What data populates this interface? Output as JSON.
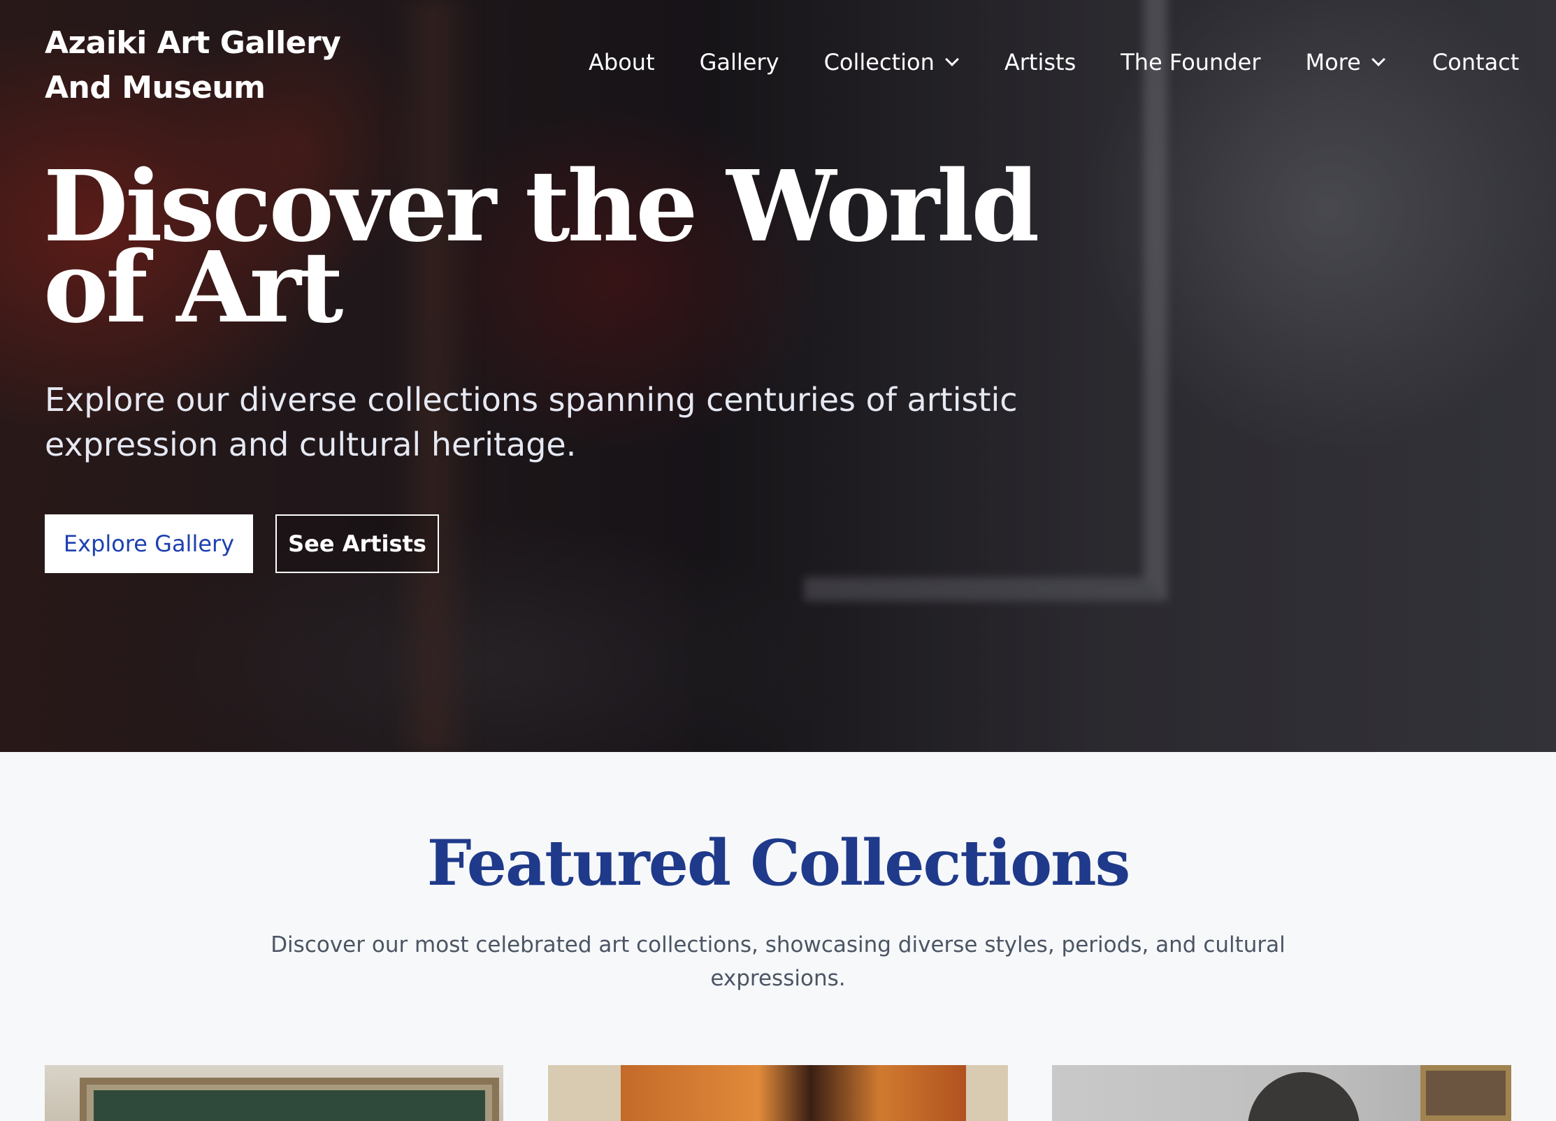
{
  "brand": {
    "line1": "Azaiki Art Gallery",
    "line2": "And Museum"
  },
  "nav": {
    "about": "About",
    "gallery": "Gallery",
    "collection": "Collection",
    "artists": "Artists",
    "founder": "The Founder",
    "more": "More",
    "contact": "Contact"
  },
  "hero": {
    "title_line1": "Discover the World",
    "title_line2": "of Art",
    "subtitle": "Explore our diverse collections spanning centuries of artistic expression and cultural heritage.",
    "primary_button": "Explore Gallery",
    "secondary_button": "See Artists"
  },
  "featured": {
    "title": "Featured Collections",
    "description": "Discover our most celebrated art collections, showcasing diverse styles, periods, and cultural expressions."
  },
  "icons": {
    "collection_dropdown": "chevron-down-icon",
    "more_dropdown": "chevron-down-icon"
  },
  "colors": {
    "accent_blue": "#1f3a8a",
    "button_text_blue": "#1e40b0",
    "hero_text": "#ffffff",
    "page_bg": "#f7f8fa"
  }
}
